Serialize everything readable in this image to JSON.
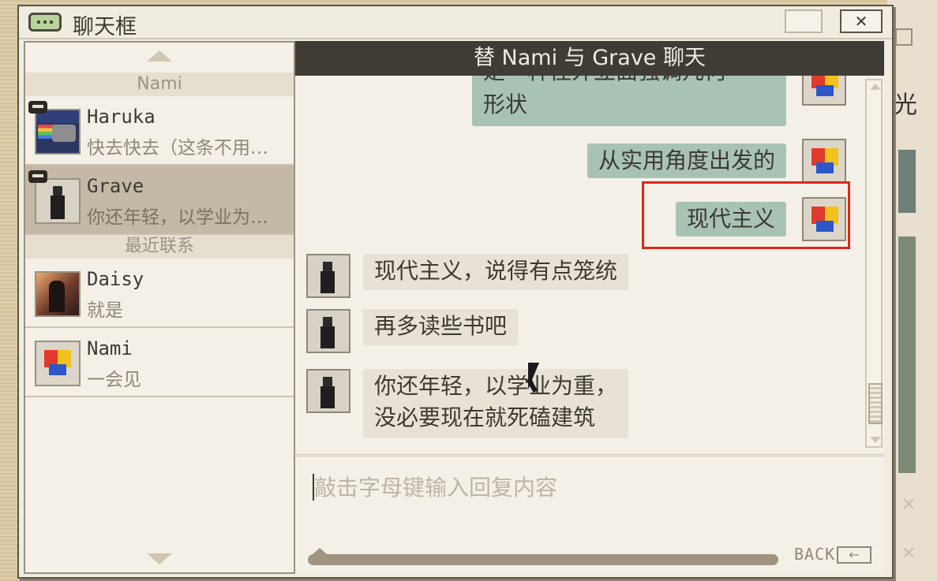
{
  "window": {
    "title": "聊天框",
    "close_label": "✕"
  },
  "sidebar": {
    "section_current": "Nami",
    "section_recent": "最近联系",
    "contacts_current": [
      {
        "name": "Haruka",
        "preview": "快去快去（这条不用…"
      },
      {
        "name": "Grave",
        "preview": "你还年轻，以学业为…"
      }
    ],
    "contacts_recent": [
      {
        "name": "Daisy",
        "preview": "就是"
      },
      {
        "name": "Nami",
        "preview": "一会见"
      }
    ]
  },
  "chat": {
    "header": "替 Nami 与 Grave 聊天",
    "messages_out": [
      {
        "text_line1": "是一种往外立面强调几何",
        "text_line2": "形状"
      },
      {
        "text": "从实用角度出发的"
      },
      {
        "text": "现代主义"
      }
    ],
    "messages_in": [
      {
        "text": "现代主义，说得有点笼统"
      },
      {
        "text": "再多读些书吧"
      },
      {
        "text_line1": "你还年轻，以学业为重，",
        "text_line2": "没必要现在就死磕建筑"
      }
    ]
  },
  "input": {
    "placeholder": "敲击字母键输入回复内容",
    "value": ""
  },
  "footer": {
    "back_label": "BACK",
    "back_icon": "←"
  },
  "background": {
    "glyph": "光"
  },
  "colors": {
    "header_bg": "#3f3c36",
    "outgoing_bubble": "#a8c3b4",
    "incoming_bubble": "#e8e1d5",
    "highlight": "#e2261c",
    "active_contact": "#c4b9a6"
  }
}
